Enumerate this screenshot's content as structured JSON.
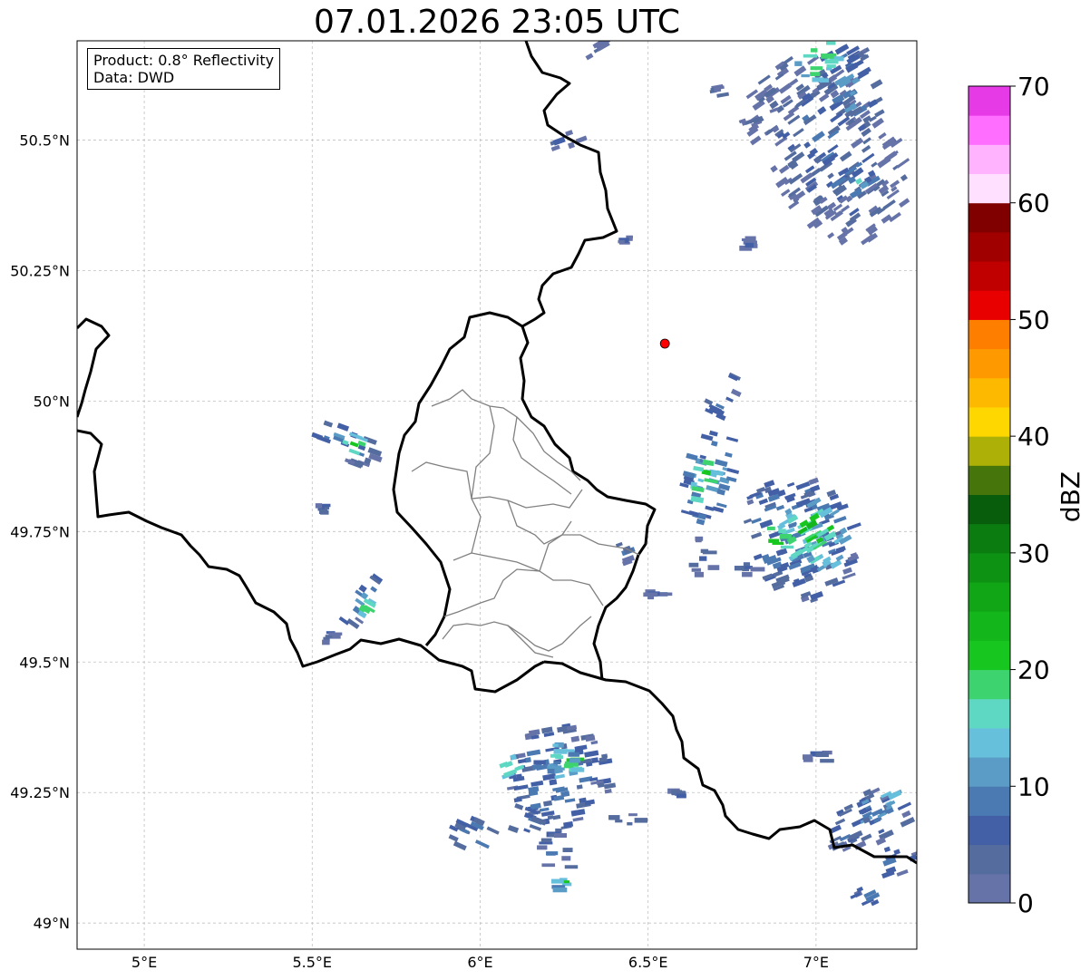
{
  "title": "07.01.2026 23:05 UTC",
  "info": {
    "product": "Product: 0.8° Reflectivity",
    "source": "Data: DWD"
  },
  "axes": {
    "lon_ticks": [
      {
        "value": 5.0,
        "label": "5°E"
      },
      {
        "value": 5.5,
        "label": "5.5°E"
      },
      {
        "value": 6.0,
        "label": "6°E"
      },
      {
        "value": 6.5,
        "label": "6.5°E"
      },
      {
        "value": 7.0,
        "label": "7°E"
      }
    ],
    "lat_ticks": [
      {
        "value": 49.0,
        "label": "49°N"
      },
      {
        "value": 49.25,
        "label": "49.25°N"
      },
      {
        "value": 49.5,
        "label": "49.5°N"
      },
      {
        "value": 49.75,
        "label": "49.75°N"
      },
      {
        "value": 50.0,
        "label": "50°N"
      },
      {
        "value": 50.25,
        "label": "50.25°N"
      },
      {
        "value": 50.5,
        "label": "50.5°N"
      }
    ],
    "grid": true
  },
  "colorbar": {
    "title": "dBZ",
    "min": 0,
    "max": 70,
    "tick_labels": [
      "0",
      "10",
      "20",
      "30",
      "40",
      "50",
      "60",
      "70"
    ],
    "colors": [
      "#6673a8",
      "#556c9e",
      "#4360a6",
      "#4b79b2",
      "#5b9cc7",
      "#66bfdb",
      "#5fd8c3",
      "#3dd46f",
      "#17c71f",
      "#14b71b",
      "#11a616",
      "#0e9213",
      "#0b7c10",
      "#075d0b",
      "#46760b",
      "#adb107",
      "#fed700",
      "#fdb900",
      "#fe9a00",
      "#fe7e00",
      "#e80000",
      "#c00000",
      "#a00000",
      "#800000",
      "#ffe0ff",
      "#ffb3ff",
      "#ff6eff",
      "#e73ae7"
    ]
  },
  "marker": {
    "name": "radar-site",
    "lon": 6.55,
    "lat": 50.11,
    "color": "#ff0000"
  },
  "echoes": [
    {
      "lon": 7.03,
      "lat": 50.48,
      "rx": 0.19,
      "ry": 0.2,
      "rot": -35,
      "dbz": 8
    },
    {
      "lon": 7.1,
      "lat": 50.6,
      "rx": 0.1,
      "ry": 0.08,
      "rot": -30,
      "dbz": 12
    },
    {
      "lon": 7.0,
      "lat": 50.66,
      "rx": 0.06,
      "ry": 0.05,
      "rot": 0,
      "dbz": 22
    },
    {
      "lon": 7.12,
      "lat": 50.42,
      "rx": 0.06,
      "ry": 0.04,
      "rot": -30,
      "dbz": 14
    },
    {
      "lon": 6.7,
      "lat": 50.59,
      "rx": 0.04,
      "ry": 0.015,
      "rot": -10,
      "dbz": 6
    },
    {
      "lon": 6.83,
      "lat": 50.54,
      "rx": 0.06,
      "ry": 0.012,
      "rot": -20,
      "dbz": 6
    },
    {
      "lon": 6.8,
      "lat": 50.3,
      "rx": 0.02,
      "ry": 0.015,
      "rot": 0,
      "dbz": 6
    },
    {
      "lon": 6.25,
      "lat": 50.5,
      "rx": 0.05,
      "ry": 0.02,
      "rot": -20,
      "dbz": 7
    },
    {
      "lon": 6.35,
      "lat": 50.67,
      "rx": 0.03,
      "ry": 0.02,
      "rot": -30,
      "dbz": 6
    },
    {
      "lon": 6.43,
      "lat": 50.31,
      "rx": 0.02,
      "ry": 0.01,
      "rot": 0,
      "dbz": 6
    },
    {
      "lon": 6.72,
      "lat": 50.01,
      "rx": 0.035,
      "ry": 0.06,
      "rot": 25,
      "dbz": 10
    },
    {
      "lon": 6.68,
      "lat": 49.86,
      "rx": 0.07,
      "ry": 0.1,
      "rot": 15,
      "dbz": 14
    },
    {
      "lon": 6.66,
      "lat": 49.86,
      "rx": 0.035,
      "ry": 0.05,
      "rot": 10,
      "dbz": 22
    },
    {
      "lon": 6.66,
      "lat": 49.7,
      "rx": 0.04,
      "ry": 0.04,
      "rot": 0,
      "dbz": 8
    },
    {
      "lon": 6.95,
      "lat": 49.74,
      "rx": 0.16,
      "ry": 0.13,
      "rot": -20,
      "dbz": 12
    },
    {
      "lon": 6.99,
      "lat": 49.74,
      "rx": 0.1,
      "ry": 0.07,
      "rot": -30,
      "dbz": 20
    },
    {
      "lon": 7.0,
      "lat": 49.76,
      "rx": 0.05,
      "ry": 0.03,
      "rot": -30,
      "dbz": 28
    },
    {
      "lon": 6.88,
      "lat": 49.73,
      "rx": 0.04,
      "ry": 0.03,
      "rot": 0,
      "dbz": 24
    },
    {
      "lon": 6.78,
      "lat": 49.68,
      "rx": 0.04,
      "ry": 0.012,
      "rot": 0,
      "dbz": 7
    },
    {
      "lon": 6.43,
      "lat": 49.71,
      "rx": 0.03,
      "ry": 0.02,
      "rot": -20,
      "dbz": 7
    },
    {
      "lon": 6.52,
      "lat": 49.63,
      "rx": 0.03,
      "ry": 0.01,
      "rot": 0,
      "dbz": 7
    },
    {
      "lon": 5.6,
      "lat": 49.92,
      "rx": 0.1,
      "ry": 0.035,
      "rot": 20,
      "dbz": 11
    },
    {
      "lon": 5.63,
      "lat": 49.92,
      "rx": 0.035,
      "ry": 0.02,
      "rot": 20,
      "dbz": 22
    },
    {
      "lon": 5.53,
      "lat": 49.8,
      "rx": 0.01,
      "ry": 0.02,
      "rot": 0,
      "dbz": 7
    },
    {
      "lon": 5.65,
      "lat": 49.62,
      "rx": 0.03,
      "ry": 0.07,
      "rot": 35,
      "dbz": 11
    },
    {
      "lon": 5.66,
      "lat": 49.6,
      "rx": 0.015,
      "ry": 0.02,
      "rot": 30,
      "dbz": 22
    },
    {
      "lon": 6.23,
      "lat": 49.28,
      "rx": 0.16,
      "ry": 0.1,
      "rot": -10,
      "dbz": 11
    },
    {
      "lon": 6.27,
      "lat": 49.32,
      "rx": 0.05,
      "ry": 0.035,
      "rot": 0,
      "dbz": 22
    },
    {
      "lon": 6.1,
      "lat": 49.3,
      "rx": 0.05,
      "ry": 0.02,
      "rot": -20,
      "dbz": 20
    },
    {
      "lon": 6.22,
      "lat": 49.32,
      "rx": 0.06,
      "ry": 0.03,
      "rot": 0,
      "dbz": 16
    },
    {
      "lon": 5.98,
      "lat": 49.17,
      "rx": 0.08,
      "ry": 0.035,
      "rot": 25,
      "dbz": 10
    },
    {
      "lon": 6.22,
      "lat": 49.13,
      "rx": 0.05,
      "ry": 0.05,
      "rot": 0,
      "dbz": 10
    },
    {
      "lon": 6.24,
      "lat": 49.08,
      "rx": 0.02,
      "ry": 0.02,
      "rot": 0,
      "dbz": 20
    },
    {
      "lon": 6.13,
      "lat": 49.2,
      "rx": 0.05,
      "ry": 0.03,
      "rot": 20,
      "dbz": 10
    },
    {
      "lon": 6.42,
      "lat": 49.2,
      "rx": 0.06,
      "ry": 0.015,
      "rot": 0,
      "dbz": 8
    },
    {
      "lon": 6.6,
      "lat": 49.25,
      "rx": 0.04,
      "ry": 0.012,
      "rot": 0,
      "dbz": 7
    },
    {
      "lon": 7.15,
      "lat": 49.2,
      "rx": 0.15,
      "ry": 0.05,
      "rot": -25,
      "dbz": 10
    },
    {
      "lon": 7.2,
      "lat": 49.23,
      "rx": 0.08,
      "ry": 0.03,
      "rot": -25,
      "dbz": 15
    },
    {
      "lon": 7.15,
      "lat": 49.05,
      "rx": 0.07,
      "ry": 0.02,
      "rot": -25,
      "dbz": 10
    },
    {
      "lon": 7.0,
      "lat": 49.32,
      "rx": 0.04,
      "ry": 0.02,
      "rot": 0,
      "dbz": 8
    },
    {
      "lon": 7.24,
      "lat": 49.12,
      "rx": 0.06,
      "ry": 0.03,
      "rot": -20,
      "dbz": 11
    },
    {
      "lon": 5.55,
      "lat": 49.55,
      "rx": 0.015,
      "ry": 0.015,
      "rot": 0,
      "dbz": 6
    }
  ]
}
